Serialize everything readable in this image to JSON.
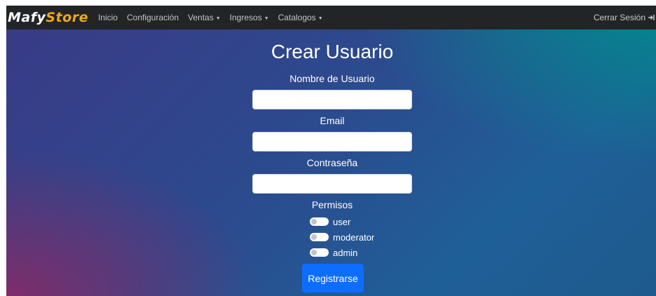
{
  "brand": {
    "part1": "Mafy",
    "part2": "Store"
  },
  "nav": {
    "items": [
      {
        "label": "Inicio",
        "dropdown": false
      },
      {
        "label": "Configuración",
        "dropdown": false
      },
      {
        "label": "Ventas",
        "dropdown": true
      },
      {
        "label": "Ingresos",
        "dropdown": true
      },
      {
        "label": "Catalogos",
        "dropdown": true
      }
    ],
    "logout": "Cerrar Sesión"
  },
  "form": {
    "title": "Crear Usuario",
    "username_label": "Nombre de Usuario",
    "username_value": "",
    "email_label": "Email",
    "email_value": "",
    "password_label": "Contraseña",
    "password_value": "",
    "permissions_label": "Permisos",
    "permissions": [
      {
        "label": "user",
        "checked": false
      },
      {
        "label": "moderator",
        "checked": false
      },
      {
        "label": "admin",
        "checked": false
      }
    ],
    "submit_label": "Registrarse"
  },
  "colors": {
    "navbar": "#222426",
    "brand_accent": "#f0a81a",
    "button": "#0d6efd"
  },
  "icons": {
    "caret": "caret-down-icon",
    "logout": "logout-arrow-icon"
  }
}
